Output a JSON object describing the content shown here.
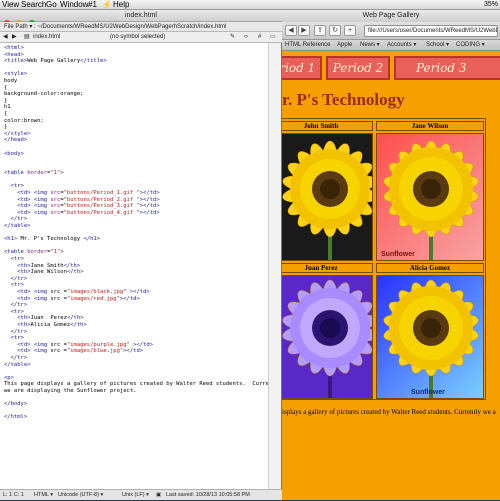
{
  "menubar": {
    "items": [
      "View",
      "Search",
      "Go",
      "Window",
      "#1",
      "Help"
    ],
    "status": "35%"
  },
  "editor": {
    "window_title": "index.html",
    "file_path": "File Path ▾ : ~/Documents/WReedMS/U2WebDesign/WebPagerhScratch/index.html",
    "tab_name": "index.html",
    "symbol_selector": "(no symbol selected)",
    "code_lines": [
      "<html>",
      "<head>",
      "<title>Web Page Gallery</title>",
      "",
      "<style>",
      "body",
      "{",
      "background-color:orange;",
      "}",
      "h1",
      "{",
      "color:brown;",
      "}",
      "</style>",
      "</head>",
      "",
      "<body>",
      "",
      "",
      "<table border=\"1\">",
      "",
      "  <tr>",
      "    <td> <img src=\"buttons/Period_1.gif \"></td>",
      "    <td> <img src=\"buttons/Period_2.gif \"></td>",
      "    <td> <img src=\"buttons/Period_3.gif \"></td>",
      "    <td> <img src=\"buttons/Period_4.gif \"></td>",
      "  </tr>",
      "</table>",
      "",
      "<h1> Mr. P's Technology </h1>",
      "",
      "<table border=\"1\">",
      "  <tr>",
      "    <th>Jane Smith</th>",
      "    <th>Jane Wilson</th>",
      "  </tr>",
      "  <tr>",
      "    <td> <img src =\"images/black.jpg\" ></td>",
      "    <td> <img src =\"images/red.jpg\"></td>",
      "  </tr>",
      "  <tr>",
      "    <th>Juan  Perez</th>",
      "    <th>Alicia Gomez</th>",
      "  </tr>",
      "  <tr>",
      "    <td> <img src =\"images/purple.jpg\" ></td>",
      "    <td> <img src =\"images/blue.jpg\"></td>",
      "  </tr>",
      "</table>",
      "",
      "<p>",
      "This page displays a gallery of pictures created by Walter Reed students.  Currently",
      "we are displaying the Sunflower project.",
      "",
      "</body>",
      "",
      "</html>"
    ],
    "status_position": "L: 1 C: 1",
    "status_syntax": "HTML ▾",
    "status_encoding": "Unicode (UTF-8) ▾",
    "status_line_endings": "Unix (LF) ▾",
    "status_saved": "Last saved: 10/28/13 10:05:58 PM"
  },
  "browser": {
    "window_title": "Web Page Gallery",
    "url": "file:///Users/user/Documents/WReedMS/U2WebDesi",
    "bookmarks": [
      "HTML Reference",
      "Apple",
      "News ▾",
      "Accounts ▾",
      "School ▾",
      "CODING ▾"
    ],
    "periods": [
      "Period 1",
      "Period 2",
      "Period 3"
    ],
    "heading": "r. P's Technology",
    "students": [
      "John Smith",
      "Jane Wilson",
      "Juan Perez",
      "Alicia Gomez"
    ],
    "image_caption": "Sunflower",
    "footer_text": "isplays a gallery of pictures created by Walter Reed students.  Currently we a",
    "colors": {
      "background": "#f5a000",
      "heading": "#9b2a1c",
      "period_button": "#e9605a"
    }
  }
}
